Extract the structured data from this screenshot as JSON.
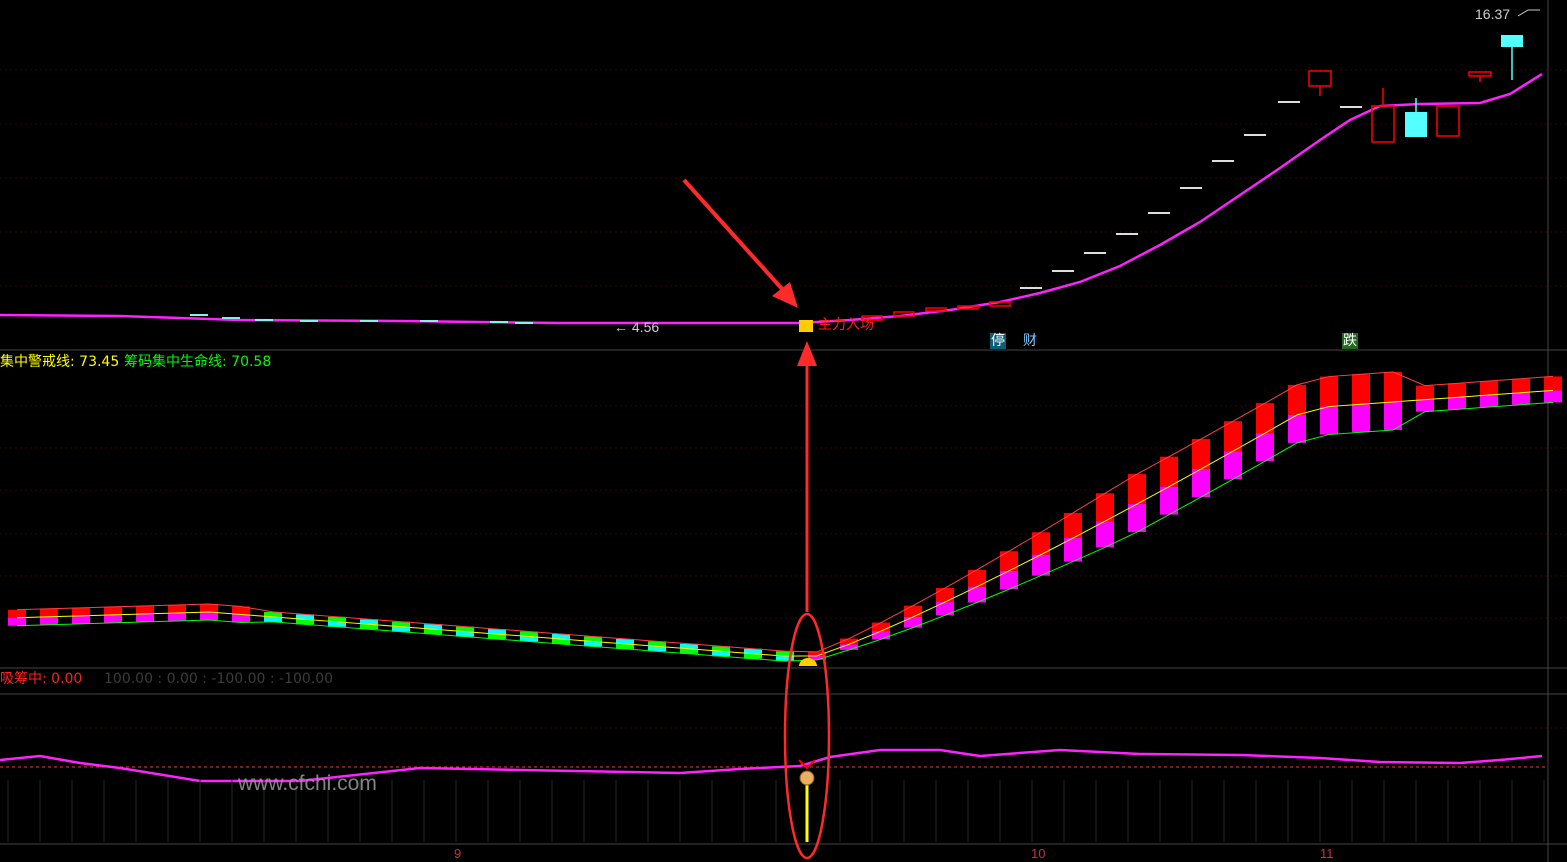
{
  "colors": {
    "background": "#000000",
    "grid": "#3a0000",
    "price_line": "#ff22ff",
    "warn": "#ffff00",
    "life": "#00ff00",
    "bar_up": "#ff0000",
    "bar_magenta": "#ff00ff",
    "bar_green": "#00ff00",
    "bar_cyan": "#00ffff",
    "candle_down": "#54ffff",
    "arrow": "#ff2a2a"
  },
  "top_panel": {
    "high_label": "16.37",
    "low_label": "← 4.56",
    "signal_text": "主力入场",
    "badge_stop": "停",
    "badge_cai": "财",
    "badge_die": "跌"
  },
  "mid_panel": {
    "warn_label": "集中警戒线: 73.45",
    "life_label": "筹码集中生命线: 70.58"
  },
  "bottom_panel": {
    "title": "吸筹中: 0.00",
    "values": "100.00  : 0.00  : -100.00  : -100.00",
    "watermark": "www.cfchi.com"
  },
  "x_axis": {
    "labels": [
      {
        "text": "9"
      },
      {
        "text": "10"
      },
      {
        "text": "11"
      }
    ]
  }
}
